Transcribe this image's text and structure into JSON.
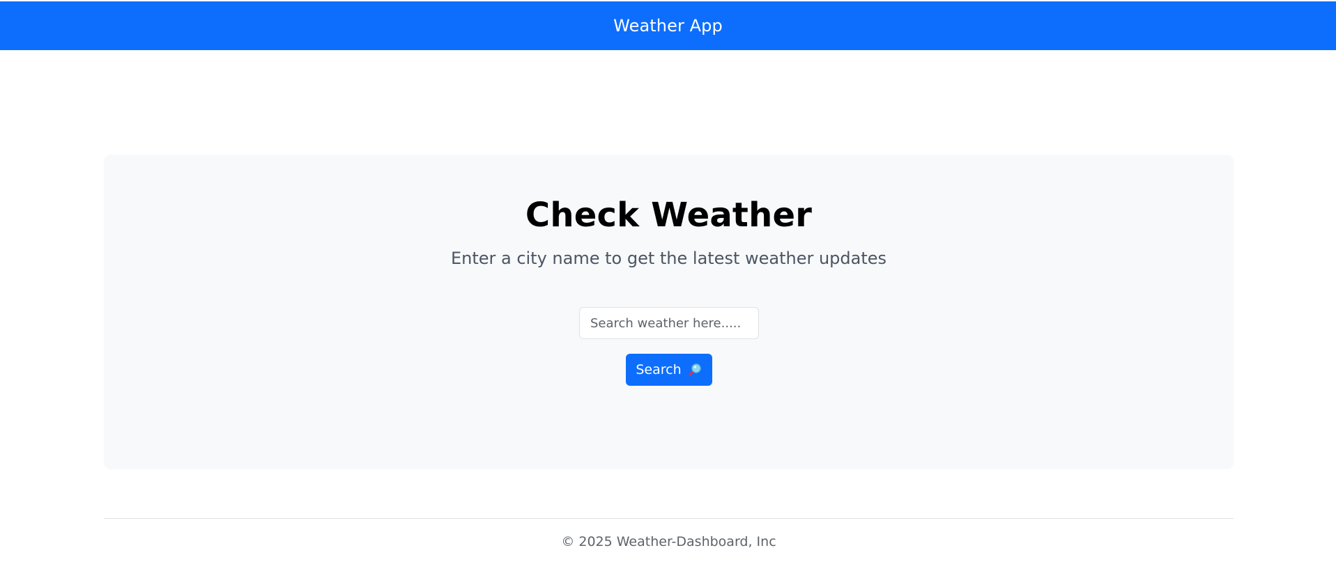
{
  "header": {
    "brand": "Weather App",
    "color": "#0d6efd"
  },
  "hero": {
    "title": "Check Weather",
    "subtitle": "Enter a city name to get the latest weather updates",
    "background": "#f8f9fa"
  },
  "search": {
    "value": "",
    "placeholder": "Search weather here.....",
    "button_label": "Search",
    "button_icon": "magnifying-glass-icon",
    "button_color": "#0d6efd"
  },
  "footer": {
    "copyright": "© 2025 Weather-Dashboard, Inc"
  }
}
